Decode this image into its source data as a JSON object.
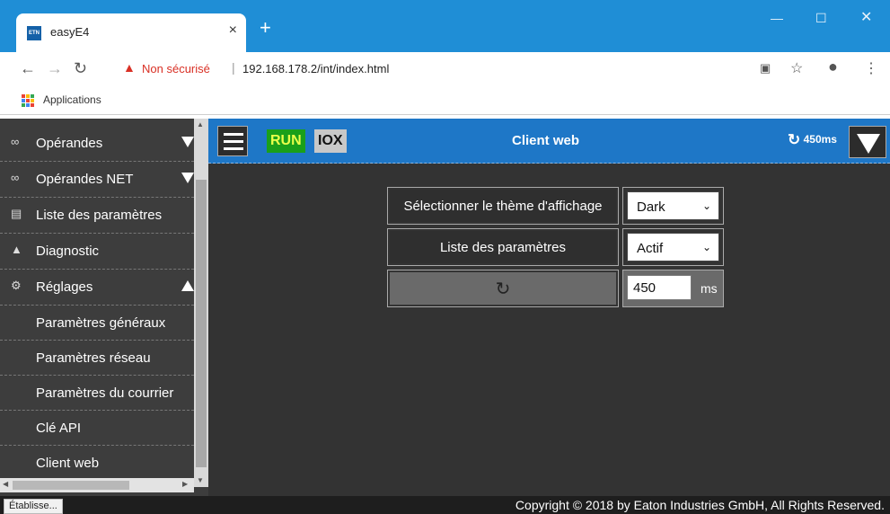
{
  "browser": {
    "tab_title": "easyE4",
    "favicon_text": "ETN",
    "tab_close": "×",
    "new_tab": "+",
    "insecure_label": "Non sécurisé",
    "url": "192.168.178.2/int/index.html",
    "bookmark_apps": "Applications",
    "accent_color": "#1f8ed6"
  },
  "sidebar": {
    "items": [
      {
        "label": "Opérandes",
        "icon": "infinity-icon",
        "glyph": "∞",
        "caret": "down"
      },
      {
        "label": "Opérandes NET",
        "icon": "infinity-icon",
        "glyph": "∞",
        "caret": "down"
      },
      {
        "label": "Liste des paramètres",
        "icon": "list-icon",
        "glyph": "▤"
      },
      {
        "label": "Diagnostic",
        "icon": "warning-icon",
        "glyph": "▲"
      },
      {
        "label": "Réglages",
        "icon": "gear-icon",
        "glyph": "⚙",
        "caret": "up"
      }
    ],
    "subitems": [
      {
        "label": "Paramètres généraux"
      },
      {
        "label": "Paramètres réseau"
      },
      {
        "label": "Paramètres du courrier"
      },
      {
        "label": "Clé API"
      },
      {
        "label": "Client web"
      }
    ]
  },
  "topbar": {
    "run": "RUN",
    "iox": "IOX",
    "title": "Client web",
    "refresh_rate": "450ms",
    "run_color": "#1aa01a",
    "bar_color": "#1e77c7"
  },
  "settings": {
    "theme_label": "Sélectionner le thème d'affichage",
    "theme_value": "Dark",
    "param_list_label": "Liste des paramètres",
    "param_list_value": "Actif",
    "refresh_icon": "refresh-icon",
    "refresh_value": "450",
    "refresh_unit": "ms"
  },
  "status": {
    "loading": "Établisse...",
    "copyright": "Copyright © 2018 by Eaton Industries GmbH, All Rights Reserved."
  }
}
